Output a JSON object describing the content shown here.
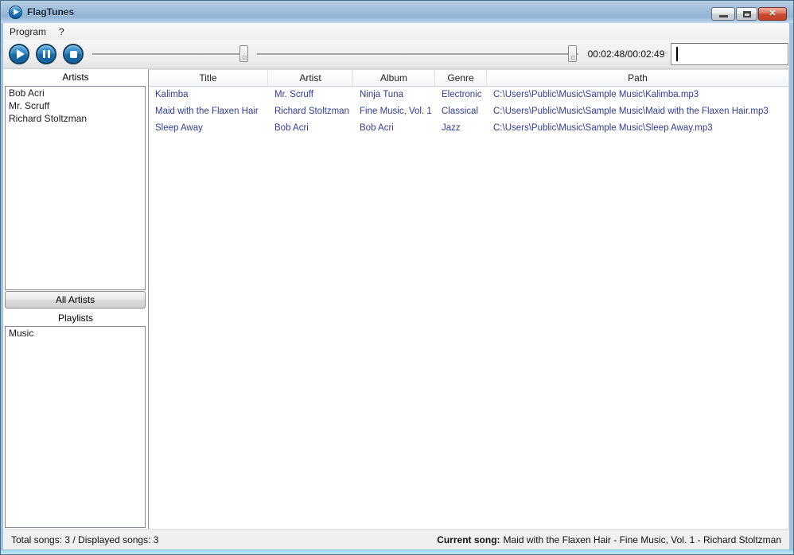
{
  "window": {
    "title": "FlagTunes",
    "close_glyph": "✕",
    "control_names": [
      "minimize",
      "maximize",
      "close"
    ]
  },
  "menu": {
    "program": "Program",
    "help": "?"
  },
  "toolbar": {
    "transport_icons": [
      "play-icon",
      "pause-icon",
      "stop-icon"
    ],
    "volume_slider_percent": 100,
    "seek_slider_percent": 97,
    "time_display": "00:02:48/00:02:49",
    "search_value": "",
    "search_placeholder": ""
  },
  "sidebar": {
    "artists_label": "Artists",
    "artists": [
      "Bob Acri",
      "Mr. Scruff",
      "Richard Stoltzman"
    ],
    "all_artists_button": "All Artists",
    "playlists_label": "Playlists",
    "playlists": [
      "Music"
    ]
  },
  "table": {
    "columns": [
      "Title",
      "Artist",
      "Album",
      "Genre",
      "Path"
    ],
    "rows": [
      [
        "Kalimba",
        "Mr. Scruff",
        "Ninja Tuna",
        "Electronic",
        "C:\\Users\\Public\\Music\\Sample Music\\Kalimba.mp3"
      ],
      [
        "Maid with the Flaxen Hair",
        "Richard Stoltzman",
        "Fine Music, Vol. 1",
        "Classical",
        "C:\\Users\\Public\\Music\\Sample Music\\Maid with the Flaxen Hair.mp3"
      ],
      [
        "Sleep Away",
        "Bob Acri",
        "Bob Acri",
        "Jazz",
        "C:\\Users\\Public\\Music\\Sample Music\\Sleep Away.mp3"
      ]
    ]
  },
  "statusbar": {
    "left_text": "Total songs: 3 / Displayed songs: 3",
    "current_song_label": "Current song:",
    "current_song_value": "Maid with the Flaxen Hair - Fine Music, Vol. 1 - Richard Stoltzman"
  },
  "colors": {
    "titlebar_blue": "#9fbcda",
    "frame_blue": "#a3c2dc",
    "bottom_strip_blue": "#a9dcee",
    "transport_button_blue": "#2d86c1",
    "table_text_navy": "#313d96",
    "close_button_red": "#c94d33"
  }
}
